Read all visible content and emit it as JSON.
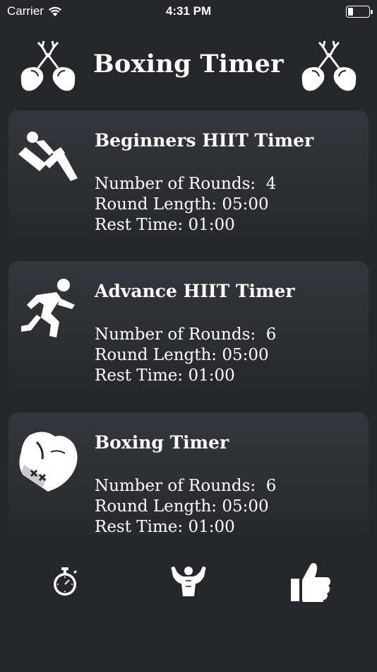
{
  "status": {
    "carrier": "Carrier",
    "time": "4:31 PM"
  },
  "header": {
    "title": "Boxing Timer",
    "left_icon": "boxing-gloves-icon",
    "right_icon": "boxing-gloves-icon"
  },
  "cards": [
    {
      "icon": "situp-exercise-icon",
      "title": "Beginners HIIT Timer",
      "rounds": "Number of Rounds:  4",
      "round_length": "Round Length: 05:00",
      "rest_time": "Rest Time: 01:00"
    },
    {
      "icon": "running-man-icon",
      "title": "Advance HIIT Timer",
      "rounds": "Number of Rounds:  6",
      "round_length": "Round Length: 05:00",
      "rest_time": "Rest Time: 01:00"
    },
    {
      "icon": "boxing-glove-icon",
      "title": "Boxing Timer",
      "rounds": "Number of Rounds:  6",
      "round_length": "Round Length: 05:00",
      "rest_time": "Rest Time: 01:00"
    }
  ],
  "tabs": [
    {
      "icon": "stopwatch-icon"
    },
    {
      "icon": "muscle-flex-icon"
    },
    {
      "icon": "thumbs-up-icon"
    }
  ],
  "colors": {
    "background": "#25272b",
    "card": "#34363b",
    "foreground": "#ffffff"
  }
}
